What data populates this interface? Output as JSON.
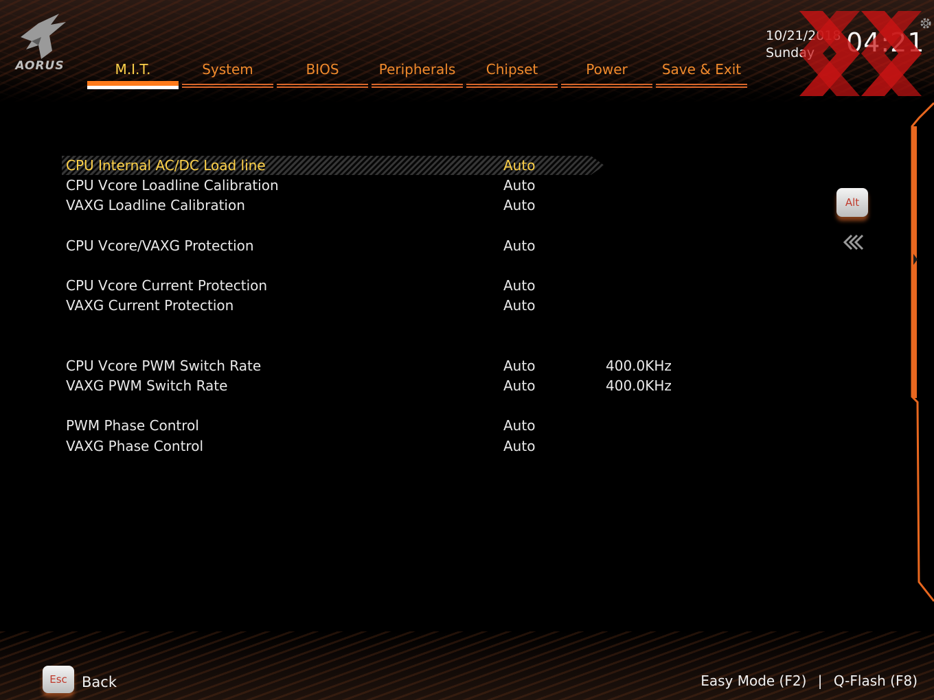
{
  "brand": {
    "logo_text": "AORUS",
    "accent_color": "#f08a2c",
    "highlight_color": "#ffd24a"
  },
  "tabs": [
    {
      "label": "M.I.T.",
      "active": true
    },
    {
      "label": "System",
      "active": false
    },
    {
      "label": "BIOS",
      "active": false
    },
    {
      "label": "Peripherals",
      "active": false
    },
    {
      "label": "Chipset",
      "active": false
    },
    {
      "label": "Power",
      "active": false
    },
    {
      "label": "Save & Exit",
      "active": false
    }
  ],
  "datetime": {
    "date": "10/21/2018",
    "day": "Sunday",
    "time": "04:21"
  },
  "settings": [
    {
      "name": "CPU Internal AC/DC Load line",
      "value": "Auto",
      "info": "",
      "selected": true
    },
    {
      "name": "CPU Vcore Loadline Calibration",
      "value": "Auto",
      "info": ""
    },
    {
      "name": "VAXG Loadline Calibration",
      "value": "Auto",
      "info": ""
    },
    {
      "name": "CPU Vcore/VAXG Protection",
      "value": "Auto",
      "info": ""
    },
    {
      "name": "CPU Vcore Current Protection",
      "value": "Auto",
      "info": ""
    },
    {
      "name": "VAXG Current Protection",
      "value": "Auto",
      "info": ""
    },
    {
      "name": "CPU Vcore PWM Switch Rate",
      "value": "Auto",
      "info": "400.0KHz"
    },
    {
      "name": "VAXG PWM Switch Rate",
      "value": "Auto",
      "info": "400.0KHz"
    },
    {
      "name": "PWM Phase Control",
      "value": "Auto",
      "info": ""
    },
    {
      "name": "VAXG Phase Control",
      "value": "Auto",
      "info": ""
    }
  ],
  "keys": {
    "alt": "Alt",
    "esc": "Esc",
    "back": "Back"
  },
  "footer": {
    "easy_mode": "Easy Mode (F2)",
    "separator": "|",
    "qflash": "Q-Flash (F8)"
  }
}
